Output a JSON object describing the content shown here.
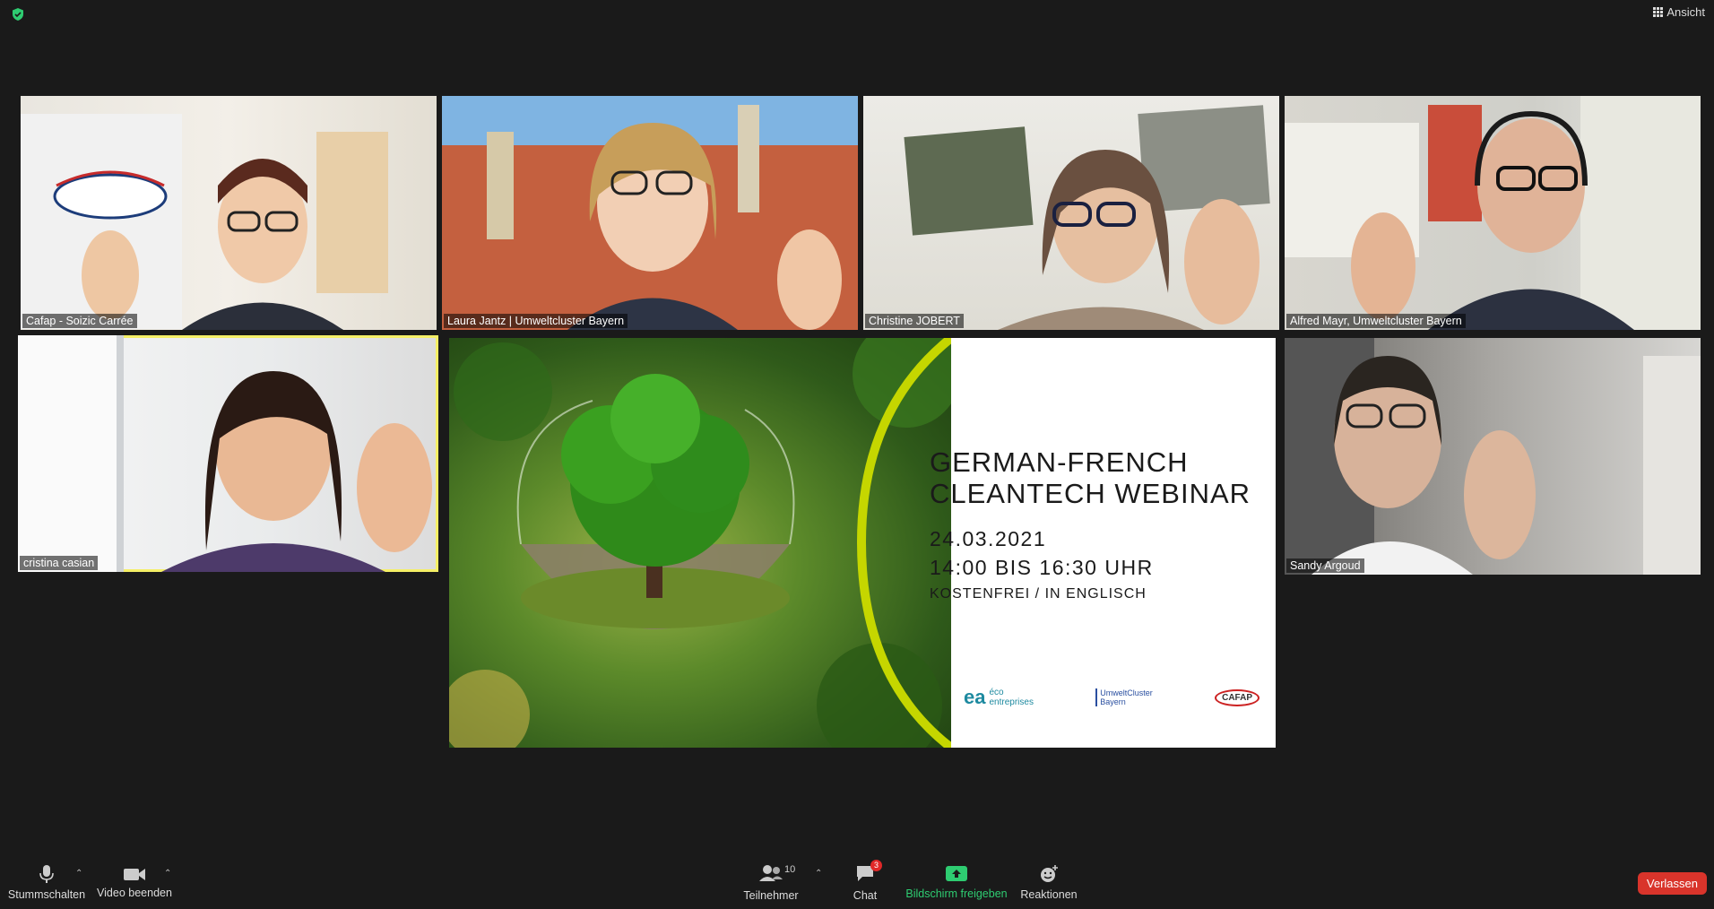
{
  "header": {
    "view_label": "Ansicht"
  },
  "participants": [
    {
      "name": "Cafap - Soizic Carrée"
    },
    {
      "name": "Laura Jantz | Umweltcluster Bayern"
    },
    {
      "name": "Christine JOBERT"
    },
    {
      "name": "Alfred Mayr, Umweltcluster Bayern"
    },
    {
      "name": "cristina casian"
    },
    {
      "name": "Sandy Argoud"
    }
  ],
  "slide": {
    "title_line1": "GERMAN-FRENCH",
    "title_line2": "CLEANTECH WEBINAR",
    "date": "24.03.2021",
    "time": "14:00 BIS 16:30 UHR",
    "subtitle": "KOSTENFREI / IN ENGLISCH",
    "logo1_letters": "ea",
    "logo1_word1": "éco",
    "logo1_word2": "entreprises",
    "logo2_line1": "UmweltCluster",
    "logo2_line2": "Bayern",
    "logo3": "CAFAP"
  },
  "toolbar": {
    "mute_label": "Stummschalten",
    "video_label": "Video beenden",
    "participants_label": "Teilnehmer",
    "participants_count": "10",
    "chat_label": "Chat",
    "chat_badge": "3",
    "share_label": "Bildschirm freigeben",
    "reactions_label": "Reaktionen",
    "leave_label": "Verlassen"
  },
  "colors": {
    "active_speaker": "#f5ef66",
    "leave": "#d9342b",
    "share": "#2ecc71"
  }
}
